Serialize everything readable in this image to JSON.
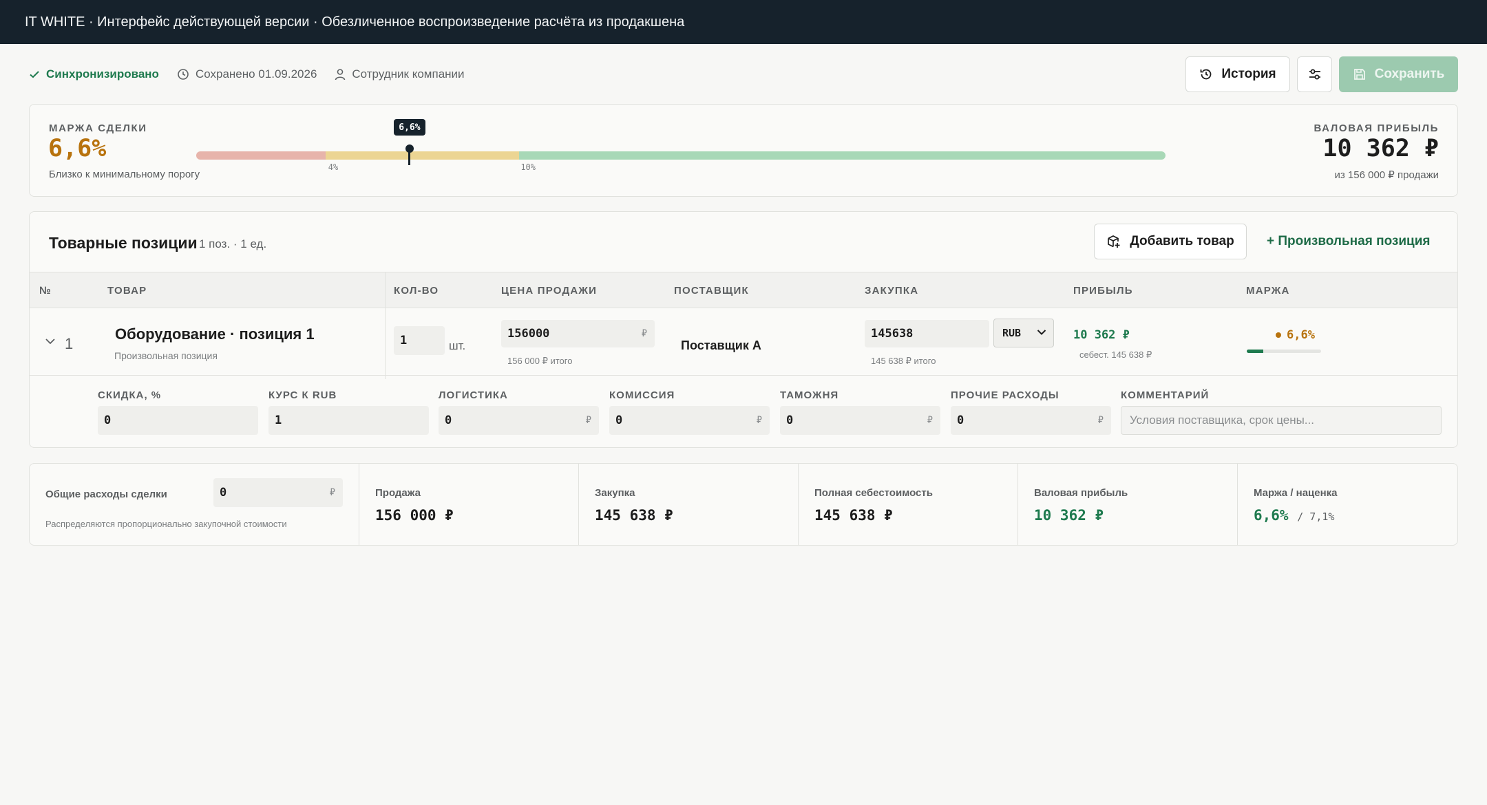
{
  "app": {
    "title": "IT WHITE · Интерфейс действующей версии · Обезличенное воспроизведение расчёта из продакшена"
  },
  "toolbar": {
    "sync_status": "Синхронизировано",
    "saved": "Сохранено 01.09.2026",
    "user": "Сотрудник компании",
    "history_label": "История",
    "save_label": "Сохранить"
  },
  "margin": {
    "label": "МАРЖА СДЕЛКИ",
    "value": "6,6%",
    "note": "Близко к минимальному порогу",
    "pin_label": "6,6%",
    "threshold_low_label": "4%",
    "threshold_high_label": "10%",
    "pin_value": 6.6,
    "threshold_low": 4,
    "threshold_high": 10,
    "scale_max": 30,
    "gross_profit_label": "ВАЛОВАЯ ПРИБЫЛЬ",
    "gross_profit_value": "10 362 ₽",
    "gross_profit_note": "из 156 000 ₽ продажи",
    "colors": {
      "low": "#e7b4ab",
      "mid": "#ecd593",
      "high": "#a8d8b7",
      "accent": "#b8730e"
    }
  },
  "items": {
    "title": "Товарные позиции",
    "count": "1 поз. · 1 ед.",
    "add_button": "Добавить товар",
    "custom_link": "+ Произвольная позиция",
    "columns": {
      "num": "№",
      "product": "ТОВАР",
      "qty": "КОЛ-ВО",
      "price": "ЦЕНА ПРОДАЖИ",
      "supplier": "ПОСТАВЩИК",
      "purchase": "ЗАКУПКА",
      "profit": "ПРИБЫЛЬ",
      "margin": "МАРЖА"
    },
    "rows": [
      {
        "num": "1",
        "name": "Оборудование · позиция 1",
        "kind": "Произвольная позиция",
        "qty": "1",
        "qty_unit": "шт.",
        "price": "156000",
        "price_currency": "₽",
        "price_total": "156 000 ₽ итого",
        "supplier": "Поставщик А",
        "purchase": "145638",
        "purchase_total": "145 638 ₽ итого",
        "currency": "RUB",
        "profit": "10 362 ₽",
        "cost_note": "себест. 145 638 ₽",
        "margin": "6,6%",
        "margin_fraction": 0.22
      }
    ],
    "extra": {
      "discount_label": "СКИДКА, %",
      "discount_value": "0",
      "rate_label": "КУРС К RUB",
      "rate_value": "1",
      "logistics_label": "ЛОГИСТИКА",
      "logistics_value": "0",
      "commission_label": "КОМИССИЯ",
      "commission_value": "0",
      "customs_label": "ТАМОЖНЯ",
      "customs_value": "0",
      "other_label": "ПРОЧИЕ РАСХОДЫ",
      "other_value": "0",
      "comment_label": "КОММЕНТАРИЙ",
      "comment_placeholder": "Условия поставщика, срок цены...",
      "currency": "₽"
    }
  },
  "summary": {
    "overhead_label": "Общие расходы сделки",
    "overhead_value": "0",
    "overhead_currency": "₽",
    "overhead_note": "Распределяются пропорционально закупочной стоимости",
    "sale_label": "Продажа",
    "sale_value": "156 000 ₽",
    "purchase_label": "Закупка",
    "purchase_value": "145 638 ₽",
    "full_cost_label": "Полная себестоимость",
    "full_cost_value": "145 638 ₽",
    "gross_label": "Валовая прибыль",
    "gross_value": "10 362 ₽",
    "margin_label": "Маржа / наценка",
    "margin_value": "6,6%",
    "markup_value": "/ 7,1%"
  }
}
